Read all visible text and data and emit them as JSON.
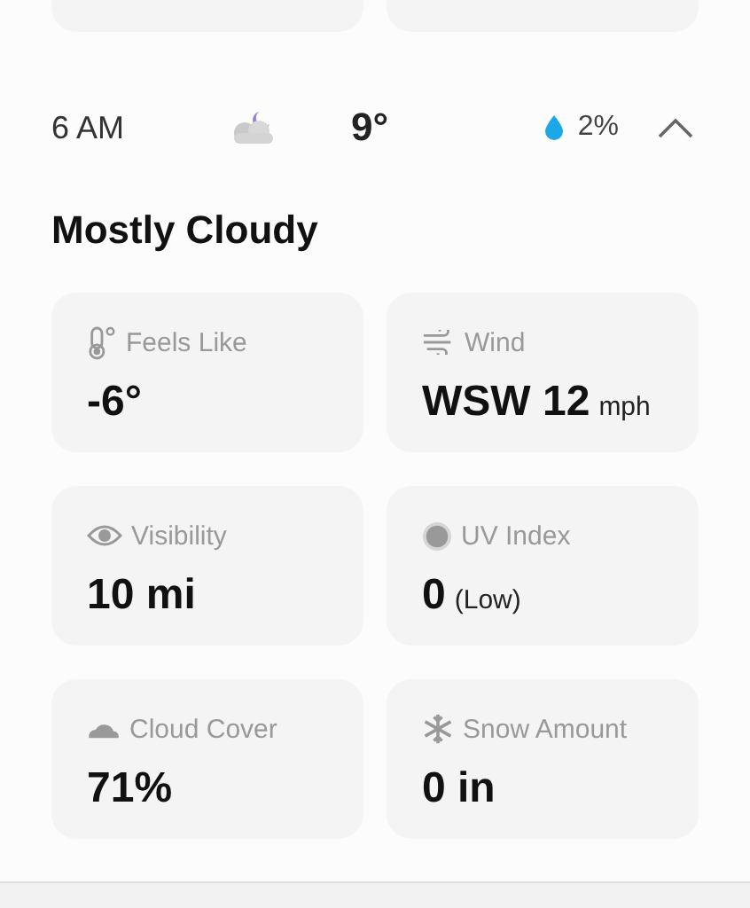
{
  "hour": {
    "time": "6 AM",
    "temperature": "9°",
    "precipitation": "2%",
    "expanded": true
  },
  "condition": "Mostly Cloudy",
  "details": [
    {
      "kind": "thermometer",
      "label": "Feels Like",
      "value": "-6°"
    },
    {
      "kind": "wind",
      "label": "Wind",
      "value": "WSW 12",
      "unit": "mph"
    },
    {
      "kind": "eye",
      "label": "Visibility",
      "value": "10 mi"
    },
    {
      "kind": "uv",
      "label": "UV Index",
      "value": "0",
      "unit": "(Low)"
    },
    {
      "kind": "cloud",
      "label": "Cloud Cover",
      "value": "71%"
    },
    {
      "kind": "snow",
      "label": "Snow Amount",
      "value": "0 in"
    }
  ]
}
